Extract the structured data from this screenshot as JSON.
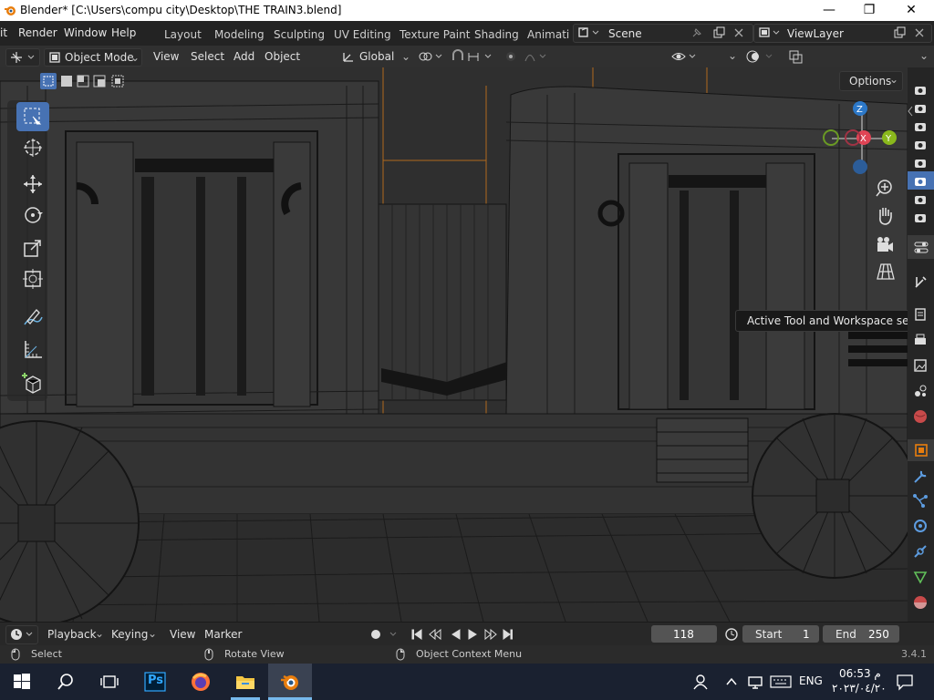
{
  "window": {
    "title": "Blender* [C:\\Users\\compu city\\Desktop\\THE TRAIN3.blend]",
    "minimize": "—",
    "maximize": "❐",
    "close": "✕"
  },
  "menubar": {
    "items": [
      "it",
      "Render",
      "Window",
      "Help"
    ],
    "workspaces": [
      "Layout",
      "Modeling",
      "Sculpting",
      "UV Editing",
      "Texture Paint",
      "Shading",
      "Animati"
    ],
    "scene": "Scene",
    "view_layer": "ViewLayer"
  },
  "header": {
    "mode": "Object Mode",
    "menus": [
      "View",
      "Select",
      "Add",
      "Object"
    ],
    "orientation": "Global",
    "options": "Options"
  },
  "gizmo": {
    "z": "Z",
    "x": "X",
    "y": "Y"
  },
  "tooltip": "Active Tool and Workspace settings",
  "timeline": {
    "menus": [
      "Playback",
      "Keying",
      "View",
      "Marker"
    ],
    "current_frame": "118",
    "start_label": "Start",
    "start_value": "1",
    "end_label": "End",
    "end_value": "250"
  },
  "statusbar": {
    "select": "Select",
    "rotate": "Rotate View",
    "context": "Object Context Menu",
    "version": "3.4.1"
  },
  "taskbar": {
    "lang": "ENG",
    "time": "06:53 م",
    "date": "٢٠٢٣/٠٤/٢٠",
    "ps_label": "Ps"
  },
  "colors": {
    "accent": "#4772b3",
    "gizmo_x": "#e04455",
    "gizmo_y": "#8ab81c",
    "gizmo_z": "#2c78c8",
    "taskbar": "#1a2130",
    "wire": "#111111",
    "selection": "#e87d0d"
  }
}
